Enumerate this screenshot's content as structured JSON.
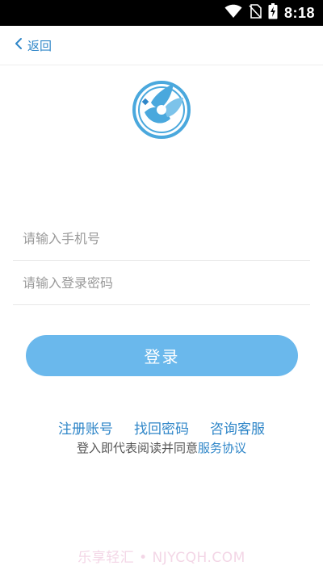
{
  "status_bar": {
    "time": "8:18",
    "icons": [
      "wifi-icon",
      "no-sim-icon",
      "battery-charging-icon"
    ]
  },
  "header": {
    "back_label": "返回"
  },
  "form": {
    "phone_placeholder": "请输入手机号",
    "password_placeholder": "请输入登录密码",
    "login_label": "登录"
  },
  "links": {
    "register": "注册账号",
    "recover_password": "找回密码",
    "customer_service": "咨询客服"
  },
  "agreement": {
    "prefix": "登入即代表阅读并同意",
    "link": "服务协议"
  },
  "watermark": "乐享轻汇 • NJYCQH.COM",
  "colors": {
    "accent": "#2f86c8",
    "button": "#6ab8ec",
    "status_bar": "#000000"
  }
}
